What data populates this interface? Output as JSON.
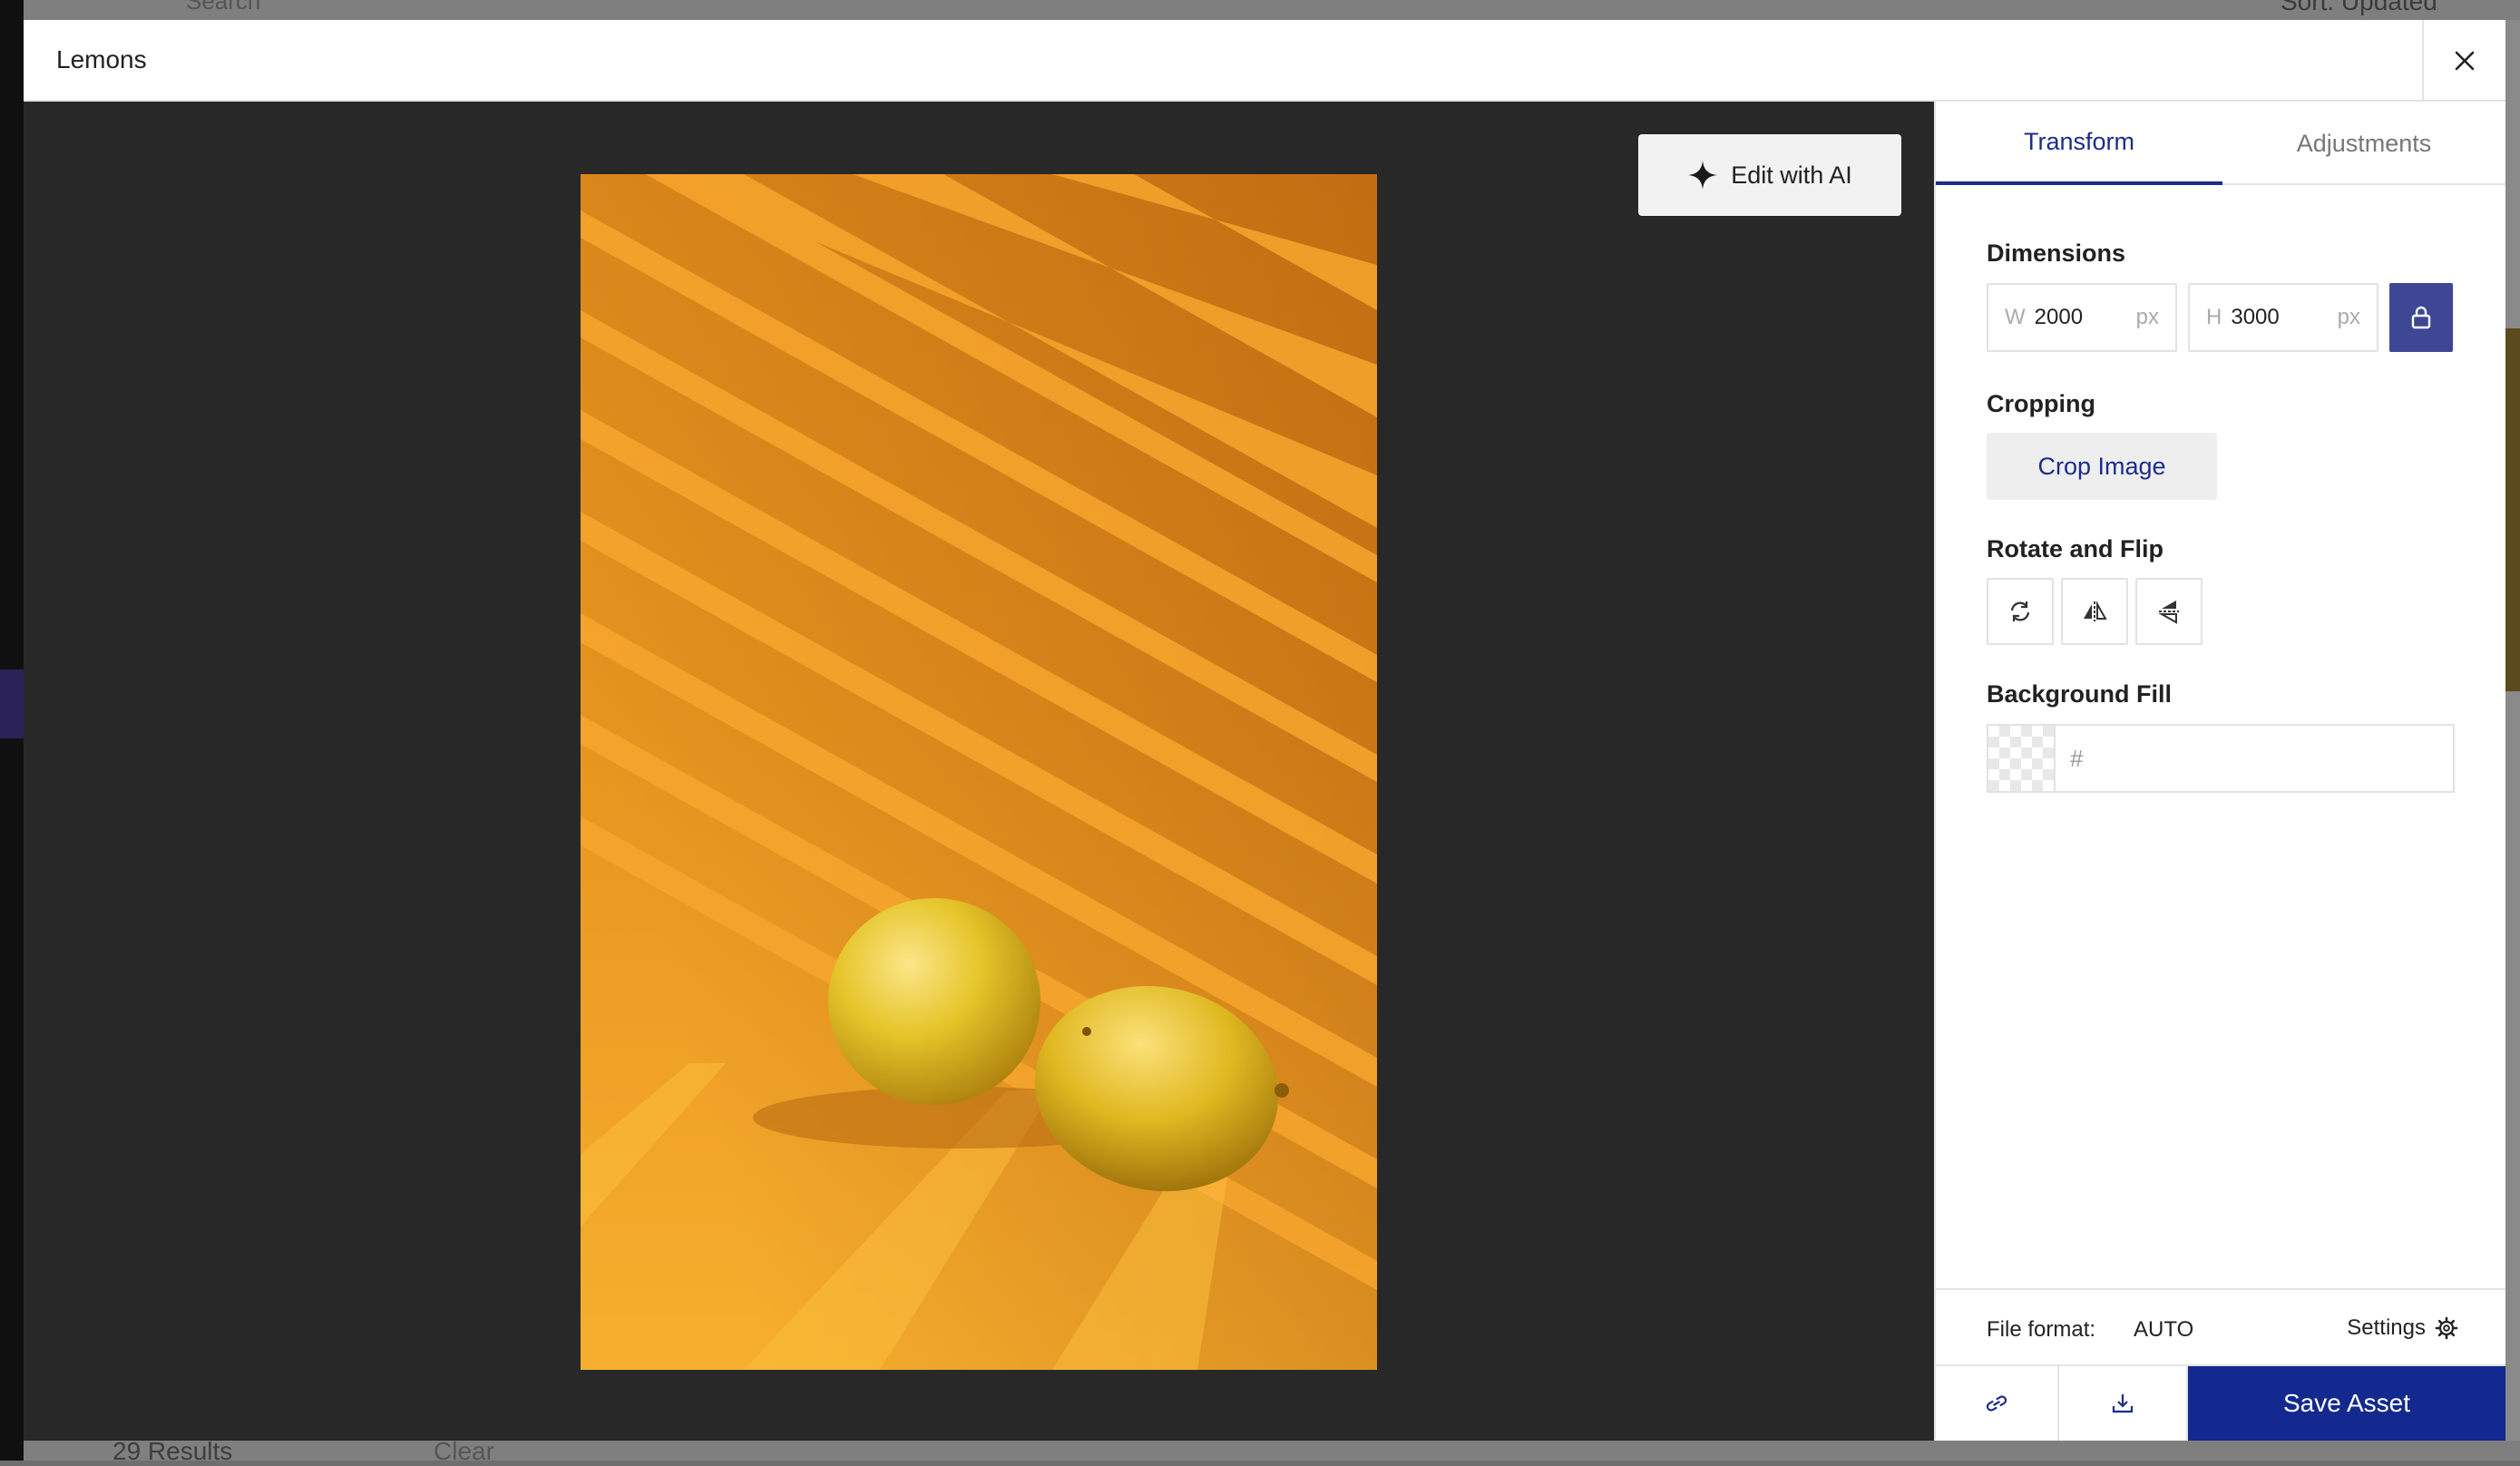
{
  "modal": {
    "title": "Lemons",
    "close_icon": "close-icon"
  },
  "background": {
    "search_placeholder": "Search",
    "sort_label": "Sort: Updated",
    "results_text": "29 Results",
    "clear_label": "Clear"
  },
  "preview": {
    "edit_ai_label": "Edit with AI",
    "edit_ai_icon": "sparkle-icon",
    "image_subject": "two lemons on orange background with diagonal shadows"
  },
  "tabs": [
    {
      "label": "Transform",
      "active": true
    },
    {
      "label": "Adjustments",
      "active": false
    }
  ],
  "dimensions": {
    "label": "Dimensions",
    "width_prefix": "W",
    "width_value": "2000",
    "height_prefix": "H",
    "height_value": "3000",
    "unit": "px",
    "lock_icon": "lock-icon",
    "accent_color": "#3d4794"
  },
  "cropping": {
    "label": "Cropping",
    "button_label": "Crop Image"
  },
  "rotate_flip": {
    "label": "Rotate and Flip",
    "buttons": [
      "rotate-icon",
      "flip-horizontal-icon",
      "flip-vertical-icon"
    ]
  },
  "background_fill": {
    "label": "Background Fill",
    "placeholder": "#"
  },
  "footer": {
    "file_format_label": "File format:",
    "file_format_value": "AUTO",
    "settings_label": "Settings",
    "settings_icon": "gear-icon",
    "link_icon": "link-icon",
    "download_icon": "download-icon",
    "save_label": "Save Asset",
    "save_color": "#13298f"
  }
}
